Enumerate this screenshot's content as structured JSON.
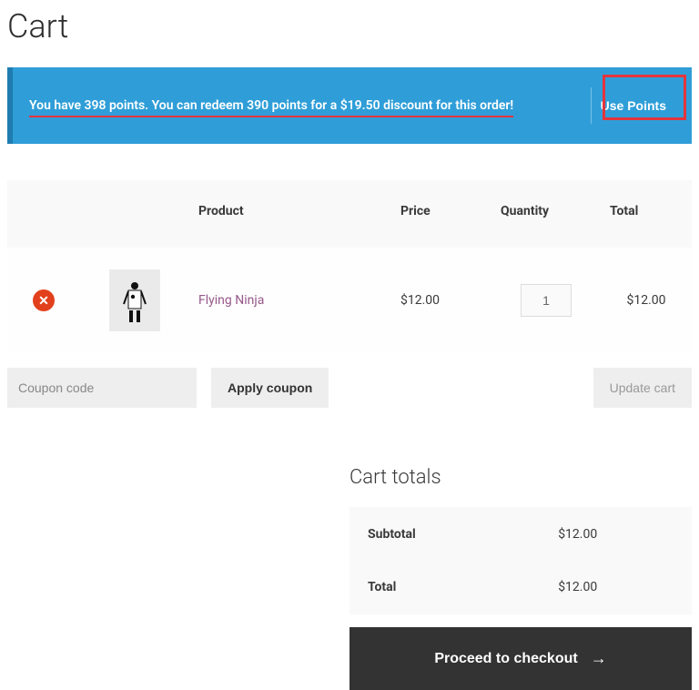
{
  "page": {
    "title": "Cart"
  },
  "points_banner": {
    "text": "You have 398 points. You can redeem 390 points for a $19.50 discount for this order!",
    "button_label": "Use Points"
  },
  "table": {
    "headers": {
      "product": "Product",
      "price": "Price",
      "quantity": "Quantity",
      "total": "Total"
    },
    "items": [
      {
        "name": "Flying Ninja",
        "price": "$12.00",
        "quantity": "1",
        "total": "$12.00"
      }
    ]
  },
  "coupon": {
    "placeholder": "Coupon code",
    "apply_label": "Apply coupon"
  },
  "update": {
    "label": "Update cart"
  },
  "cart_totals": {
    "title": "Cart totals",
    "rows": {
      "subtotal": {
        "label": "Subtotal",
        "value": "$12.00"
      },
      "total": {
        "label": "Total",
        "value": "$12.00"
      }
    },
    "checkout_label": "Proceed to checkout"
  }
}
